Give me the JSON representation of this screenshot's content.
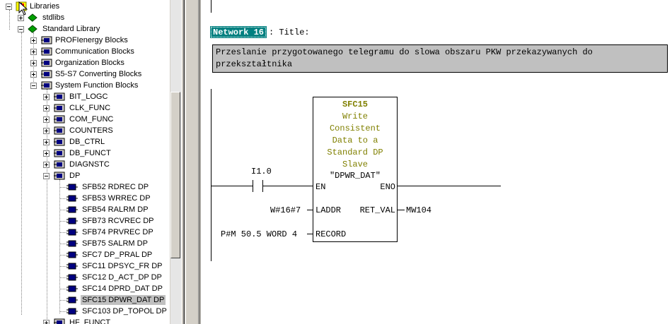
{
  "tree": {
    "items": [
      {
        "label": "Libraries",
        "icon": "libraries-icon"
      },
      {
        "label": "stdlibs",
        "icon": "library-book-icon"
      },
      {
        "label": "Standard Library",
        "icon": "library-book-icon"
      },
      {
        "label": "PROFIenergy Blocks",
        "icon": "block-folder-icon"
      },
      {
        "label": "Communication Blocks",
        "icon": "block-folder-icon"
      },
      {
        "label": "Organization Blocks",
        "icon": "block-folder-icon"
      },
      {
        "label": "S5-S7 Converting Blocks",
        "icon": "block-folder-icon"
      },
      {
        "label": "System Function Blocks",
        "icon": "block-folder-icon"
      },
      {
        "label": "BIT_LOGC",
        "icon": "block-folder-icon"
      },
      {
        "label": "CLK_FUNC",
        "icon": "block-folder-icon"
      },
      {
        "label": "COM_FUNC",
        "icon": "block-folder-icon"
      },
      {
        "label": "COUNTERS",
        "icon": "block-folder-icon"
      },
      {
        "label": "DB_CTRL",
        "icon": "block-folder-icon"
      },
      {
        "label": "DB_FUNCT",
        "icon": "block-folder-icon"
      },
      {
        "label": "DIAGNSTC",
        "icon": "block-folder-icon"
      },
      {
        "label": "DP",
        "icon": "block-folder-icon"
      },
      {
        "label": "SFB52   RDREC   DP",
        "icon": "function-block-icon"
      },
      {
        "label": "SFB53   WRREC   DP",
        "icon": "function-block-icon"
      },
      {
        "label": "SFB54   RALRM   DP",
        "icon": "function-block-icon"
      },
      {
        "label": "SFB73   RCVREC   DP",
        "icon": "function-block-icon"
      },
      {
        "label": "SFB74   PRVREC   DP",
        "icon": "function-block-icon"
      },
      {
        "label": "SFB75   SALRM   DP",
        "icon": "function-block-icon"
      },
      {
        "label": "SFC7   DP_PRAL   DP",
        "icon": "function-block-icon"
      },
      {
        "label": "SFC11   DPSYC_FR   DP",
        "icon": "function-block-icon"
      },
      {
        "label": "SFC12   D_ACT_DP   DP",
        "icon": "function-block-icon"
      },
      {
        "label": "SFC14   DPRD_DAT   DP",
        "icon": "function-block-icon"
      },
      {
        "label": "SFC15   DPWR_DAT   DP",
        "icon": "function-block-icon"
      },
      {
        "label": "SFC103   DP_TOPOL   DP",
        "icon": "function-block-icon"
      },
      {
        "label": "HF_FUNCT",
        "icon": "block-folder-icon"
      }
    ]
  },
  "network": {
    "badge": "Network 16",
    "title_suffix": ": Title:",
    "comment": "Przeslanie przygotowanego telegramu do slowa obszaru PKW przekazywanych do przekształtnika"
  },
  "fb": {
    "title_lines": [
      "SFC15",
      "Write",
      "Consistent",
      "Data to a",
      "Standard DP",
      "Slave"
    ],
    "instance": "\"DPWR_DAT\"",
    "contact": "I1.0",
    "pin_en": "EN",
    "pin_eno": "ENO",
    "pin_laddr": "LADDR",
    "pin_retval": "RET_VAL",
    "pin_record": "RECORD",
    "laddr_value": "W#16#7",
    "retval_value": "MW104",
    "record_value": "P#M 50.5 WORD 4"
  },
  "colors": {
    "network_badge": "#008080",
    "fb_title": "#808000",
    "comment_bg": "#c0c0c0",
    "selection": "#c0c0c0"
  }
}
